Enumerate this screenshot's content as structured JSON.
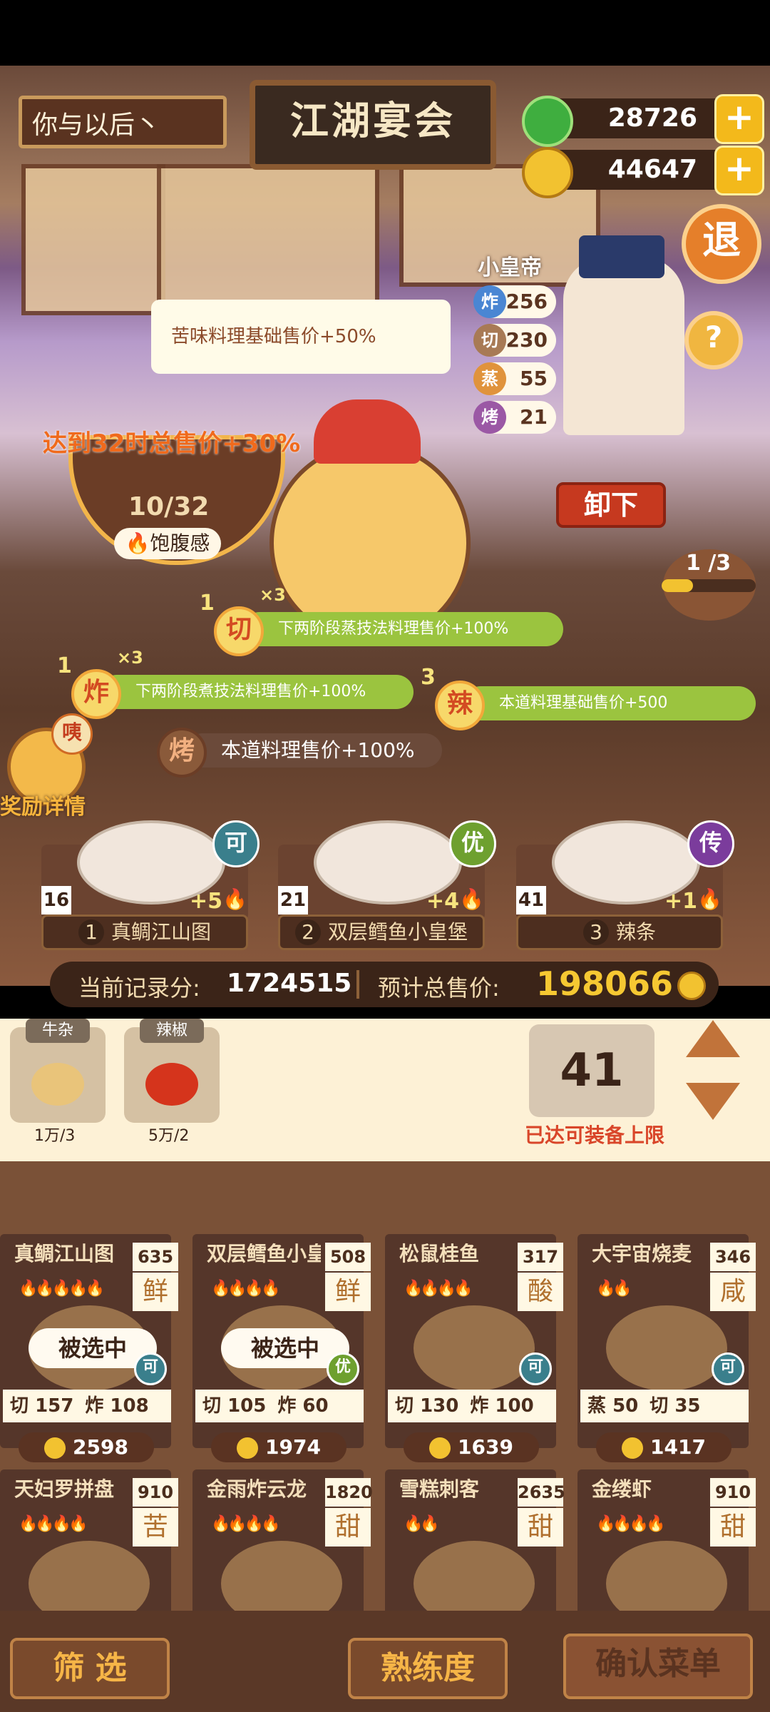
{
  "header": {
    "player_name": "你与以后丶",
    "title": "江湖宴会",
    "jade": "28726",
    "coins": "44647",
    "exit_label": "退"
  },
  "chef": {
    "name": "小皇帝",
    "stats": [
      {
        "skill": "炸",
        "value": "256",
        "color": "#4a86d3"
      },
      {
        "skill": "切",
        "value": "230",
        "color": "#a87a55"
      },
      {
        "skill": "蒸",
        "value": "55",
        "color": "#e0933c"
      },
      {
        "skill": "烤",
        "value": "21",
        "color": "#9b58a5"
      }
    ],
    "unload_label": "卸下"
  },
  "tooltip": "苦味料理基础售价+50%",
  "satiety": {
    "target_text": "达到32时总售价+30%",
    "progress": "10/32",
    "label": "饱腹感"
  },
  "round_progress": "1 /3",
  "bonuses": [
    {
      "count": "1",
      "tag": "切",
      "mult": "×3",
      "text": "下两阶段蒸技法料理售价+100%"
    },
    {
      "count": "1",
      "tag": "炸",
      "mult": "×3",
      "text": "下两阶段煮技法料理售价+100%"
    },
    {
      "count": "3",
      "tag": "辣",
      "mult": "",
      "text": "本道料理基础售价+500"
    },
    {
      "count": "",
      "tag": "烤",
      "mult": "",
      "text": "本道料理售价+100%"
    }
  ],
  "reward_label": "奖励详情",
  "reward_badge": "咦",
  "menu_dishes": [
    {
      "slot": "1",
      "name": "真鲷江山图",
      "count": "16",
      "bonus": "+5",
      "grade": "可",
      "grade_color": "#3a7f8c"
    },
    {
      "slot": "2",
      "name": "双层鳕鱼小皇堡",
      "count": "21",
      "bonus": "+4",
      "grade": "优",
      "grade_color": "#6ea02f"
    },
    {
      "slot": "3",
      "name": "辣条",
      "count": "41",
      "bonus": "+1",
      "grade": "传",
      "grade_color": "#7b3c9c"
    }
  ],
  "score": {
    "record_label": "当前记录分:",
    "record_value": "1724515",
    "sale_label": "预计总售价:",
    "sale_value": "198066"
  },
  "ingredients": [
    {
      "name": "牛杂",
      "amount": "1万/3"
    },
    {
      "name": "辣椒",
      "amount": "5万/2"
    }
  ],
  "equip": {
    "count": "41",
    "limit_text": "已达可装备上限"
  },
  "recipes": [
    {
      "name": "真鲷江山图",
      "score": "635",
      "flavor": "鲜",
      "fires": 5,
      "skill1": "切",
      "val1": "157",
      "skill2": "炸",
      "val2": "108",
      "price": "2598",
      "selected": "被选中",
      "grade": "可",
      "grade_color": "#3a7f8c"
    },
    {
      "name": "双层鳕鱼小皇堡",
      "score": "508",
      "flavor": "鲜",
      "fires": 4,
      "skill1": "切",
      "val1": "105",
      "skill2": "炸",
      "val2": "60",
      "price": "1974",
      "selected": "被选中",
      "grade": "优",
      "grade_color": "#6ea02f"
    },
    {
      "name": "松鼠桂鱼",
      "score": "317",
      "flavor": "酸",
      "fires": 4,
      "skill1": "切",
      "val1": "130",
      "skill2": "炸",
      "val2": "100",
      "price": "1639",
      "selected": "",
      "grade": "可",
      "grade_color": "#3a7f8c"
    },
    {
      "name": "大宇宙烧麦",
      "score": "346",
      "flavor": "咸",
      "fires": 2,
      "skill1": "蒸",
      "val1": "50",
      "skill2": "切",
      "val2": "35",
      "price": "1417",
      "selected": "",
      "grade": "可",
      "grade_color": "#3a7f8c"
    },
    {
      "name": "天妇罗拼盘",
      "score": "910",
      "flavor": "苦",
      "fires": 4,
      "price": "",
      "selected": ""
    },
    {
      "name": "金雨炸云龙",
      "score": "1820",
      "flavor": "甜",
      "fires": 4,
      "price": "",
      "selected": ""
    },
    {
      "name": "雪糕刺客",
      "score": "2635",
      "flavor": "甜",
      "fires": 2,
      "price": "",
      "selected": ""
    },
    {
      "name": "金缕虾",
      "score": "910",
      "flavor": "甜",
      "fires": 4,
      "price": "",
      "selected": ""
    }
  ],
  "bottom": {
    "filter": "筛 选",
    "proficiency": "熟练度",
    "confirm": "确认菜单"
  },
  "colors": {
    "accent": "#f3b91b",
    "fire": "#f06a1c",
    "limit_text": "#d9462a"
  }
}
